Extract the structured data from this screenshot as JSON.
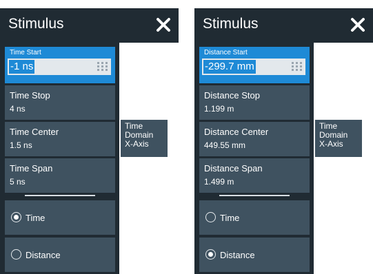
{
  "colors": {
    "panel_bg": "#202b33",
    "button_bg": "#3f5260",
    "active_bg": "#1e8ad6",
    "input_bg": "#e3e8ec",
    "text": "#ffffff"
  },
  "icons": {
    "close": "close-icon",
    "keypad": "keypad-icon",
    "radio": "radio-icon"
  },
  "left": {
    "title": "Stimulus",
    "active_field": {
      "label": "Time Start",
      "value": "-1 ns"
    },
    "fields": [
      {
        "label": "Time Stop",
        "value": "4 ns"
      },
      {
        "label": "Time Center",
        "value": "1.5 ns"
      },
      {
        "label": "Time Span",
        "value": "5 ns"
      }
    ],
    "radios": [
      {
        "label": "Time",
        "checked": true
      },
      {
        "label": "Distance",
        "checked": false
      }
    ],
    "side": {
      "lines": [
        "Time",
        "Domain",
        "X-Axis"
      ]
    }
  },
  "right": {
    "title": "Stimulus",
    "active_field": {
      "label": "Distance Start",
      "value": "-299.7 mm"
    },
    "fields": [
      {
        "label": "Distance Stop",
        "value": "1.199 m"
      },
      {
        "label": "Distance Center",
        "value": "449.55 mm"
      },
      {
        "label": "Distance Span",
        "value": "1.499 m"
      }
    ],
    "radios": [
      {
        "label": "Time",
        "checked": false
      },
      {
        "label": "Distance",
        "checked": true
      }
    ],
    "side": {
      "lines": [
        "Time",
        "Domain",
        "X-Axis"
      ]
    }
  }
}
